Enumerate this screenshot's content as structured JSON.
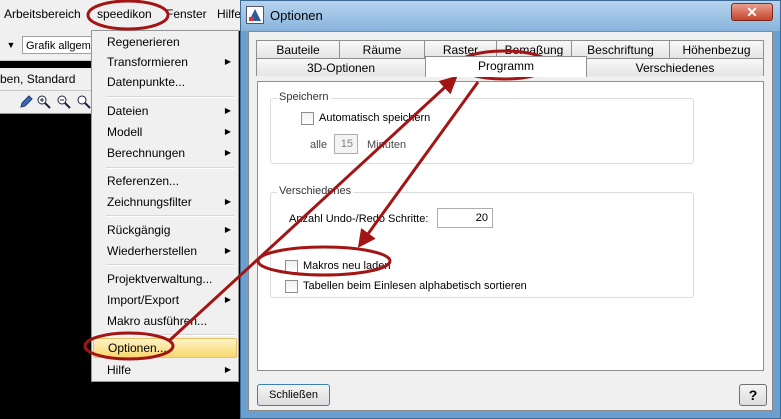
{
  "app": {
    "menubar": [
      "Arbeitsbereich",
      "speedikon",
      "Fenster",
      "Hilfe"
    ],
    "toolbar": {
      "grafik_combo": "Grafik allgemein"
    },
    "layer_bar": "ben, Standard"
  },
  "menu": {
    "items": [
      {
        "label": "Regenerieren",
        "submenu": false
      },
      {
        "label": "Transformieren",
        "submenu": true
      },
      {
        "label": "Datenpunkte...",
        "submenu": false
      },
      {
        "label": "Dateien",
        "submenu": true
      },
      {
        "label": "Modell",
        "submenu": true
      },
      {
        "label": "Berechnungen",
        "submenu": true
      },
      {
        "label": "Referenzen...",
        "submenu": false
      },
      {
        "label": "Zeichnungsfilter",
        "submenu": true
      },
      {
        "label": "Rückgängig",
        "submenu": true
      },
      {
        "label": "Wiederherstellen",
        "submenu": true
      },
      {
        "label": "Projektverwaltung...",
        "submenu": false
      },
      {
        "label": "Import/Export",
        "submenu": true
      },
      {
        "label": "Makro ausführen...",
        "submenu": false
      },
      {
        "label": "Optionen...",
        "submenu": false
      },
      {
        "label": "Hilfe",
        "submenu": true
      }
    ],
    "highlighted": "Optionen..."
  },
  "dialog": {
    "title": "Optionen",
    "close_glyph": "✕",
    "tabs_row1": [
      "Bauteile",
      "Räume",
      "Raster",
      "Bemaßung",
      "Beschriftung",
      "Höhenbezug"
    ],
    "tabs_row2": [
      "3D-Optionen",
      "Programm",
      "Verschiedenes"
    ],
    "active_tab": "Programm",
    "speichern": {
      "title": "Speichern",
      "auto_save_label": "Automatisch speichern",
      "auto_save_checked": false,
      "every_label": "alle",
      "minutes_value": "15",
      "minutes_label": "Minuten"
    },
    "verschiedenes": {
      "title": "Verschiedenes",
      "undo_label": "Anzahl Undo-/Redo Schritte:",
      "undo_value": "20",
      "macros_label": "Makros neu laden",
      "macros_checked": false,
      "sort_tables_label": "Tabellen beim Einlesen alphabetisch sortieren",
      "sort_tables_checked": false
    },
    "close_button": "Schließen",
    "help_button": "?"
  },
  "colors": {
    "annotation": "#a31515",
    "menu_highlight": "#f8d870",
    "dialog_frame": "#6aa0cf"
  }
}
